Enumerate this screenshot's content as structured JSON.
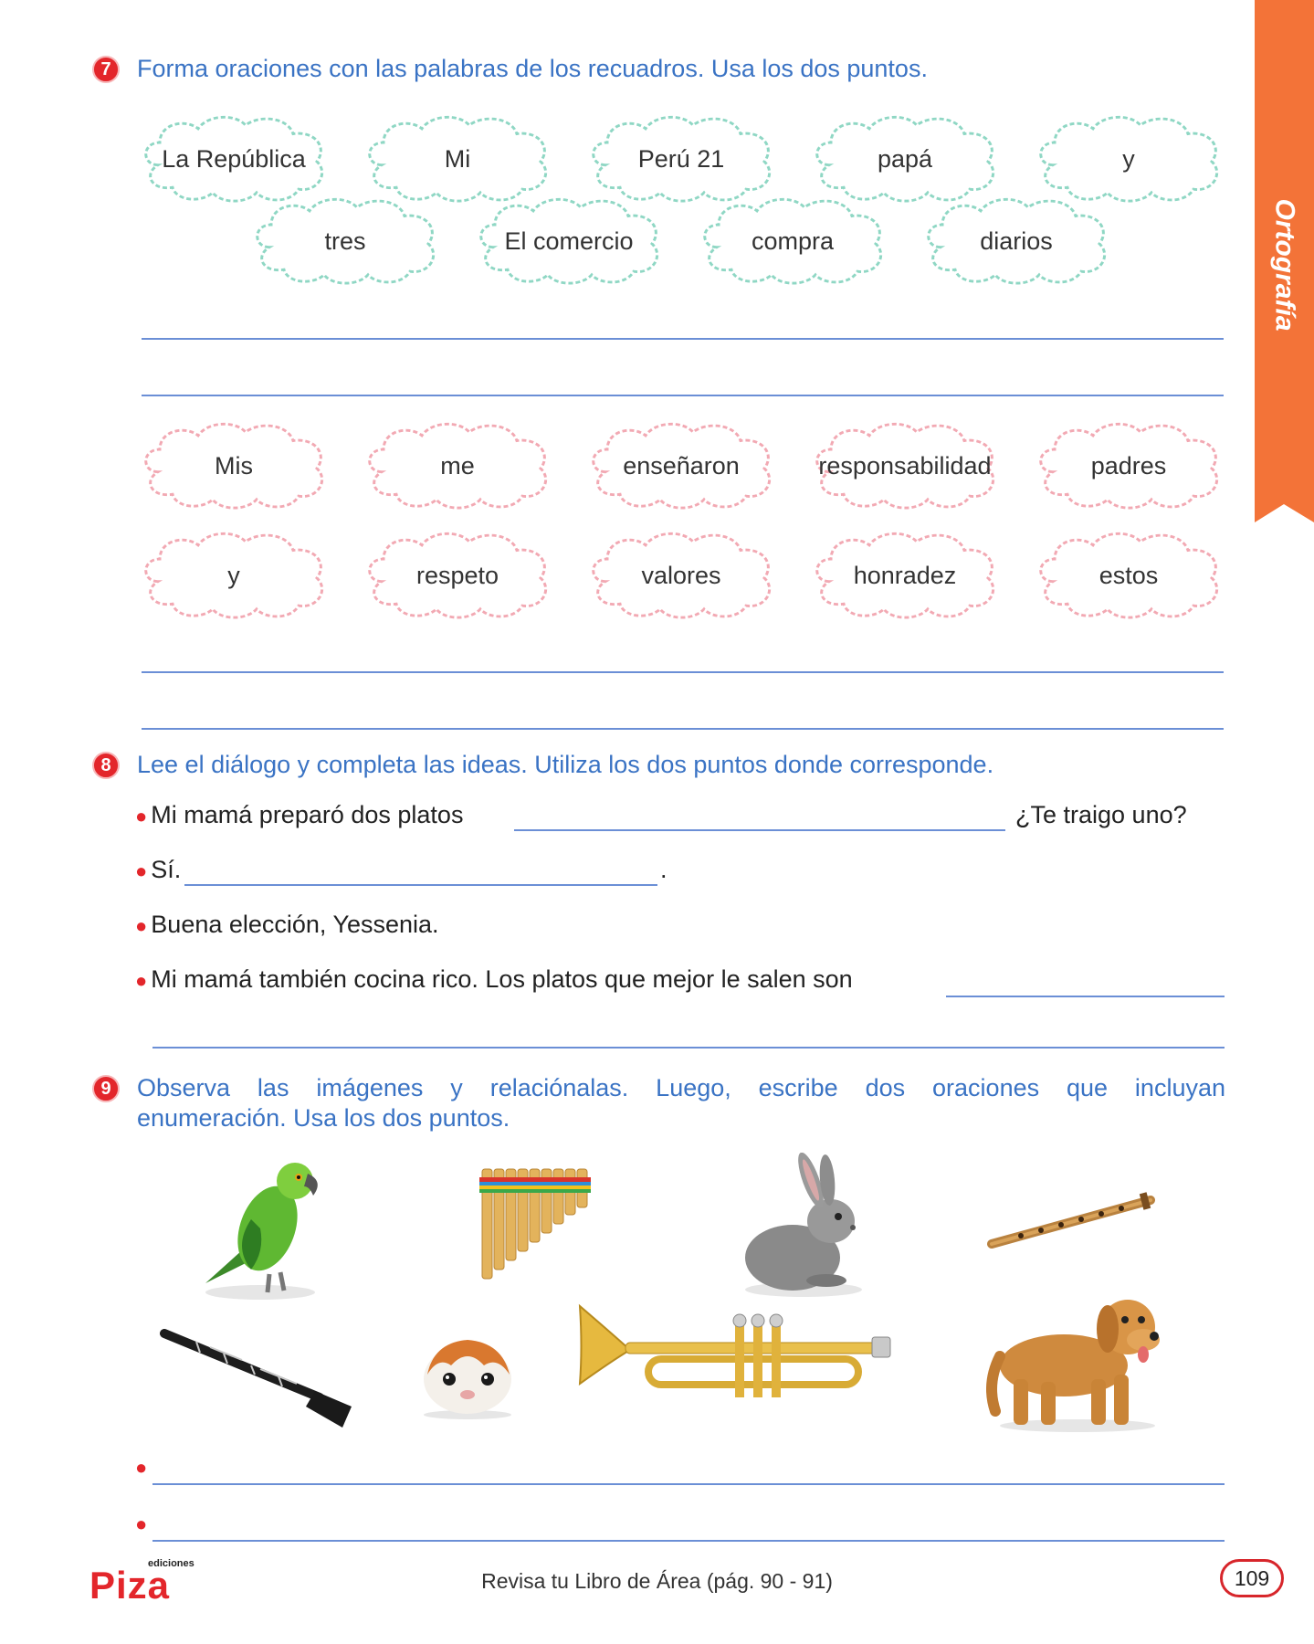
{
  "side_tab": {
    "label": "Ortografía",
    "color": "#f37338"
  },
  "ex7": {
    "number": "7",
    "instruction": "Forma oraciones con las palabras de los recuadros. Usa los dos puntos.",
    "green_words_row1": [
      "La República",
      "Mi",
      "Perú 21",
      "papá",
      "y"
    ],
    "green_words_row2": [
      "tres",
      "El comercio",
      "compra",
      "diarios"
    ],
    "pink_words_row1": [
      "Mis",
      "me",
      "enseñaron",
      "responsabilidad",
      "padres"
    ],
    "pink_words_row2": [
      "y",
      "respeto",
      "valores",
      "honradez",
      "estos"
    ]
  },
  "ex8": {
    "number": "8",
    "instruction": "Lee el diálogo y completa las ideas. Utiliza los dos puntos donde corresponde.",
    "line1_start": "Mi mamá preparó dos platos",
    "line1_end": "¿Te traigo uno?",
    "line2_start": "Sí.",
    "line2_end": ".",
    "line3": "Buena elección, Yessenia.",
    "line4": "Mi mamá también cocina rico. Los platos que mejor le salen son"
  },
  "ex9": {
    "number": "9",
    "instruction_line1": "Observa las imágenes y relaciónalas. Luego, escribe dos oraciones que incluyan",
    "instruction_line2": "enumeración. Usa los dos puntos.",
    "images": [
      "parrot-icon",
      "panpipe-icon",
      "rabbit-icon",
      "flute-icon",
      "clarinet-icon",
      "guinea-pig-icon",
      "trumpet-icon",
      "dog-icon"
    ]
  },
  "footer": {
    "brand_small": "ediciones",
    "brand": "Piza",
    "review_text": "Revisa tu Libro de Área (pág. 90 - 91)",
    "page_number": "109"
  },
  "colors": {
    "green_cloud": "#8fd7c4",
    "pink_cloud": "#f2a9b3",
    "blue_text": "#3a73c4",
    "red": "#e3262b"
  }
}
